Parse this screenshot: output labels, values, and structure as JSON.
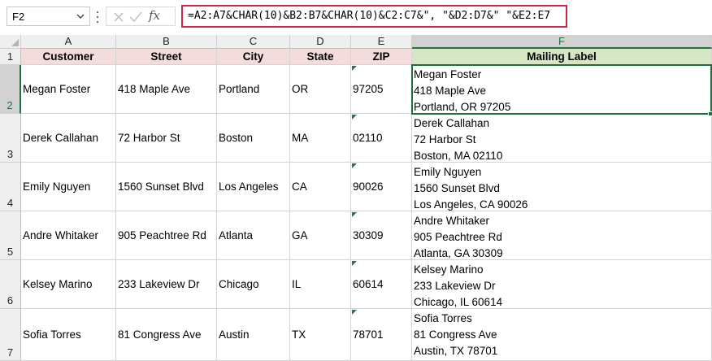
{
  "name_box": {
    "value": "F2"
  },
  "formula_bar": {
    "fx_label": "fx",
    "formula": "=A2:A7&CHAR(10)&B2:B7&CHAR(10)&C2:C7&\", \"&D2:D7&\" \"&E2:E7"
  },
  "grid": {
    "columns": [
      "A",
      "B",
      "C",
      "D",
      "E",
      "F"
    ],
    "selected_column": "F",
    "rows": [
      "1",
      "2",
      "3",
      "4",
      "5",
      "6",
      "7"
    ],
    "selected_row": "2",
    "headers": [
      "Customer",
      "Street",
      "City",
      "State",
      "ZIP",
      "Mailing Label"
    ],
    "records": [
      {
        "customer": "Megan Foster",
        "street": "418 Maple Ave",
        "city": "Portland",
        "state": "OR",
        "zip": "97205",
        "label": [
          "Megan Foster",
          "418 Maple Ave",
          "Portland, OR 97205"
        ]
      },
      {
        "customer": "Derek Callahan",
        "street": "72 Harbor St",
        "city": "Boston",
        "state": "MA",
        "zip": "02110",
        "label": [
          "Derek Callahan",
          "72 Harbor St",
          "Boston, MA 02110"
        ]
      },
      {
        "customer": "Emily Nguyen",
        "street": "1560 Sunset Blvd",
        "city": "Los Angeles",
        "state": "CA",
        "zip": "90026",
        "label": [
          "Emily Nguyen",
          "1560 Sunset Blvd",
          "Los Angeles, CA 90026"
        ]
      },
      {
        "customer": "Andre Whitaker",
        "street": "905 Peachtree Rd",
        "city": "Atlanta",
        "state": "GA",
        "zip": "30309",
        "label": [
          "Andre Whitaker",
          "905 Peachtree Rd",
          "Atlanta, GA 30309"
        ]
      },
      {
        "customer": "Kelsey Marino",
        "street": "233 Lakeview Dr",
        "city": "Chicago",
        "state": "IL",
        "zip": "60614",
        "label": [
          "Kelsey Marino",
          "233 Lakeview Dr",
          "Chicago, IL 60614"
        ]
      },
      {
        "customer": "Sofia Torres",
        "street": "81 Congress Ave",
        "city": "Austin",
        "state": "TX",
        "zip": "78701",
        "label": [
          "Sofia Torres",
          "81 Congress Ave",
          "Austin, TX 78701"
        ]
      }
    ]
  },
  "colors": {
    "header_fill": "#f3dcdc",
    "mailing_header_fill": "#d7e7c6",
    "selection": "#1e6e42",
    "formula_highlight": "#d0234a"
  }
}
